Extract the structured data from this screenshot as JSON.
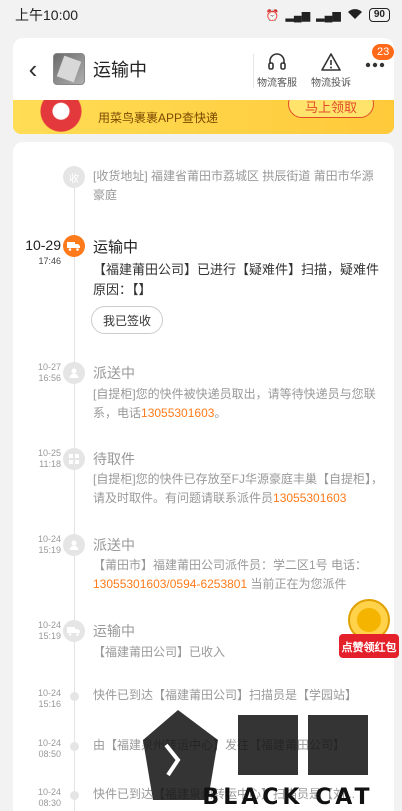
{
  "status": {
    "time": "上午10:00",
    "battery": "90"
  },
  "header": {
    "title": "运输中",
    "service_label": "物流客服",
    "complaint_label": "物流投诉",
    "badge_count": "23"
  },
  "banner": {
    "text": "用菜鸟裹裹APP查快递",
    "button_label": "马上领取"
  },
  "address": {
    "node": "收",
    "text": "[收货地址] 福建省莆田市荔城区  拱辰街道 莆田市华源豪庭"
  },
  "events": [
    {
      "date": "10-29",
      "time": "17:46",
      "title": "运输中",
      "desc": "【福建莆田公司】已进行【疑难件】扫描，疑难件原因：【】"
    },
    {
      "date": "10-27",
      "time": "16:56",
      "title": "派送中",
      "desc_a": "[自提柜]您的快件被快递员取出，请等待快递员与您联系，电话",
      "phone": "13055301603",
      "desc_b": "。"
    },
    {
      "date": "10-25",
      "time": "11:18",
      "title": "待取件",
      "desc_a": "[自提柜]您的快件已存放至FJ华源豪庭丰巢【自提柜】，请及时取件。有问题请联系派件员",
      "phone": "13055301603",
      "desc_b": ""
    },
    {
      "date": "10-24",
      "time": "15:19",
      "title": "派送中",
      "desc_a": "【莆田市】福建莆田公司派件员：学二区1号 电话：",
      "phone": "13055301603/0594-6253801",
      "desc_b": " 当前正在为您派件"
    },
    {
      "date": "10-24",
      "time": "15:19",
      "title": "运输中",
      "desc": "【福建莆田公司】已收入"
    },
    {
      "date": "10-24",
      "time": "15:16",
      "desc": "快件已到达【福建莆田公司】扫描员是【学园站】"
    },
    {
      "date": "10-24",
      "time": "08:50",
      "desc": "由【福建泉州转运中心】发往【福建莆田公司】"
    },
    {
      "date": "10-24",
      "time": "08:30",
      "desc": "快件已到达【福建泉州转运中心】扫描员是【刘..."
    }
  ],
  "sign_button": "我已签收",
  "redpack_label": "点赞领红包",
  "watermark": "BLACK CAT"
}
